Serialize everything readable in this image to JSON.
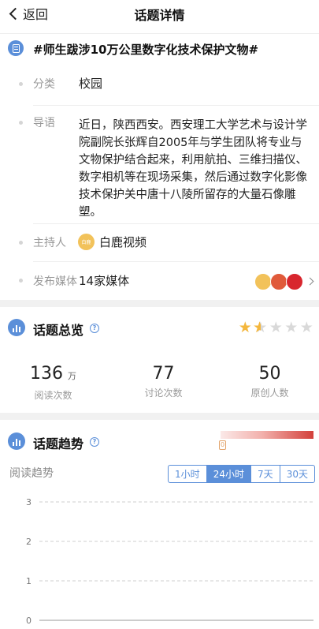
{
  "nav": {
    "back_label": "返回",
    "title": "话题详情"
  },
  "topic": {
    "icon": "document-icon",
    "title": "#师生跋涉10万公里数字化技术保护文物#"
  },
  "info": {
    "category_label": "分类",
    "category_value": "校园",
    "guide_label": "导语",
    "guide_text": "近日，陕西西安。西安理工大学艺术与设计学院副院长张辉自2005年与学生团队将专业与文物保护结合起来，利用航拍、三维扫描仪、数字相机等在现场采集，然后通过数字化影像技术保护关中唐十八陵所留存的大量石像雕塑。",
    "host_label": "主持人",
    "host_value": "白鹿视频",
    "media_label": "发布媒体",
    "media_value": "14家媒体",
    "media_logo_colors": [
      "#f2c25a",
      "#e05a3a",
      "#d8262e"
    ]
  },
  "overview": {
    "title": "话题总览",
    "rating": 1.5,
    "rating_max": 5,
    "star_color": "#f4b73d",
    "stats": [
      {
        "value": "136",
        "unit": "万",
        "label": "阅读次数"
      },
      {
        "value": "77",
        "unit": "",
        "label": "讨论次数"
      },
      {
        "value": "50",
        "unit": "",
        "label": "原创人数"
      }
    ]
  },
  "trend": {
    "title": "话题趋势",
    "heat_marker": "0",
    "heat_level": 0,
    "chart_label": "阅读趋势",
    "ranges": [
      "1小时",
      "24小时",
      "7天",
      "30天"
    ],
    "active_range": "24小时",
    "accent_color": "#5b8fd9"
  },
  "chart_data": {
    "type": "line",
    "title": "",
    "ylabel": "",
    "ylim": [
      0,
      3
    ],
    "yticks": [
      "0",
      "1",
      "2",
      "3"
    ],
    "grid": true,
    "x": [],
    "series": []
  }
}
